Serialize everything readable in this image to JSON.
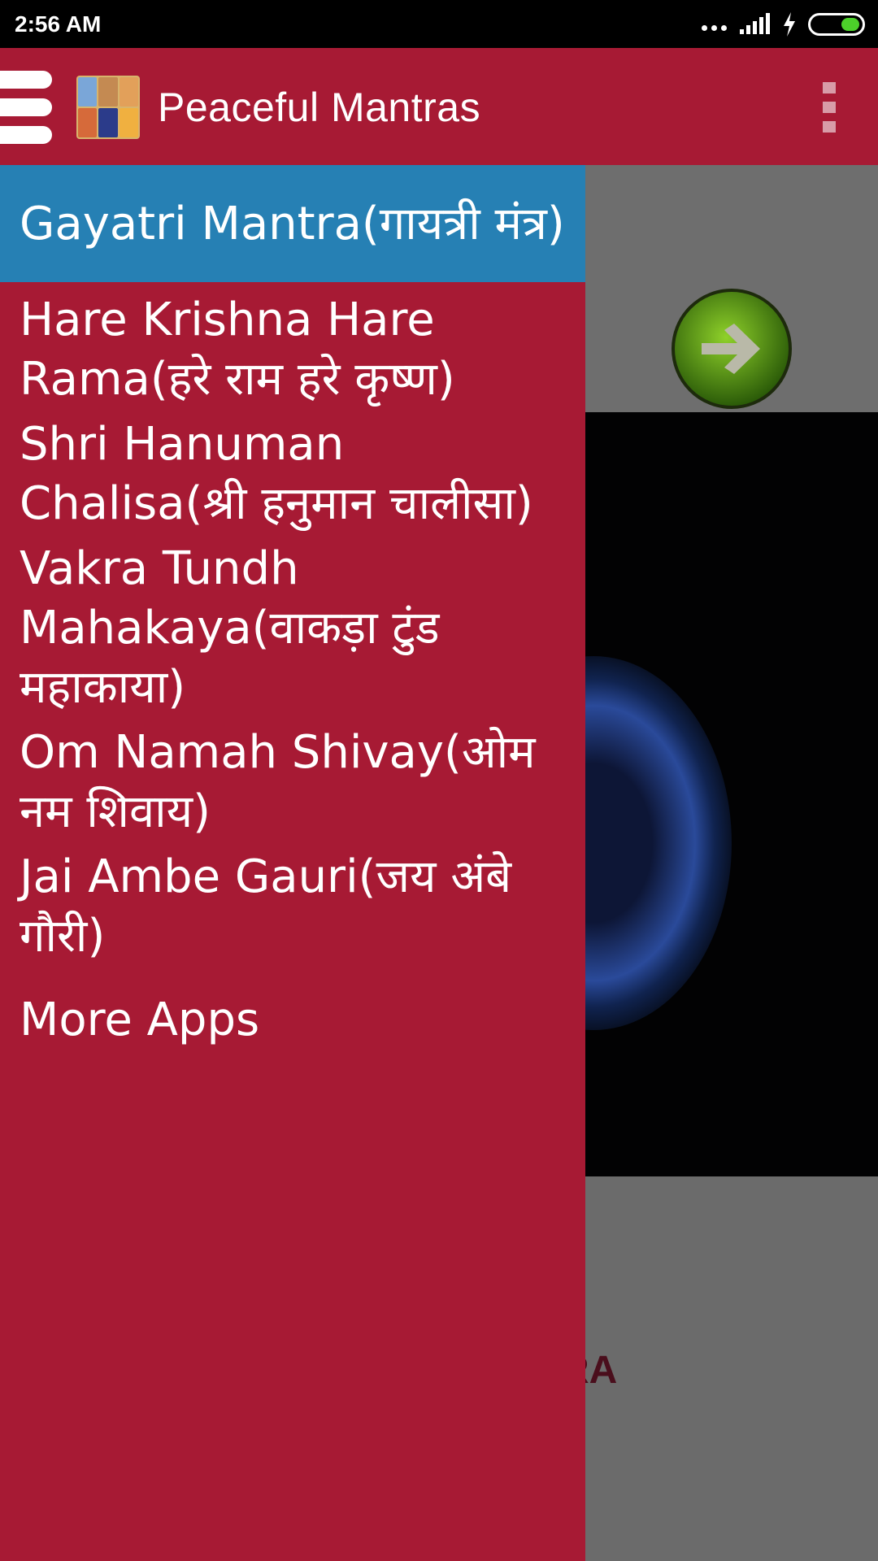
{
  "status_bar": {
    "time": "2:56 AM"
  },
  "app_bar": {
    "title": "Peaceful Mantras",
    "logo_tile_colors": [
      "#7aa6d8",
      "#c48a52",
      "#e2a05a",
      "#d66a3a",
      "#2b3b8a",
      "#f0b040"
    ]
  },
  "drawer": {
    "active_item": "Gayatri Mantra(गायत्री मंत्र)",
    "items": [
      "Hare Krishna Hare Rama(हरे राम हरे कृष्ण)",
      "Shri Hanuman Chalisa(श्री हनुमान चालीसा)",
      "Vakra Tundh Mahakaya(वाकड़ा टुंड महाकाया)",
      "Om Namah Shivay(ओम नम शिवाय)",
      "Jai Ambe Gauri(जय अंबे गौरी)"
    ],
    "more_apps": "More Apps"
  },
  "background": {
    "partial_text": "RA"
  },
  "colors": {
    "primary": "#a71a34",
    "active_item": "#2680b4",
    "status_bar": "#000000",
    "battery": "#4cd12a"
  }
}
